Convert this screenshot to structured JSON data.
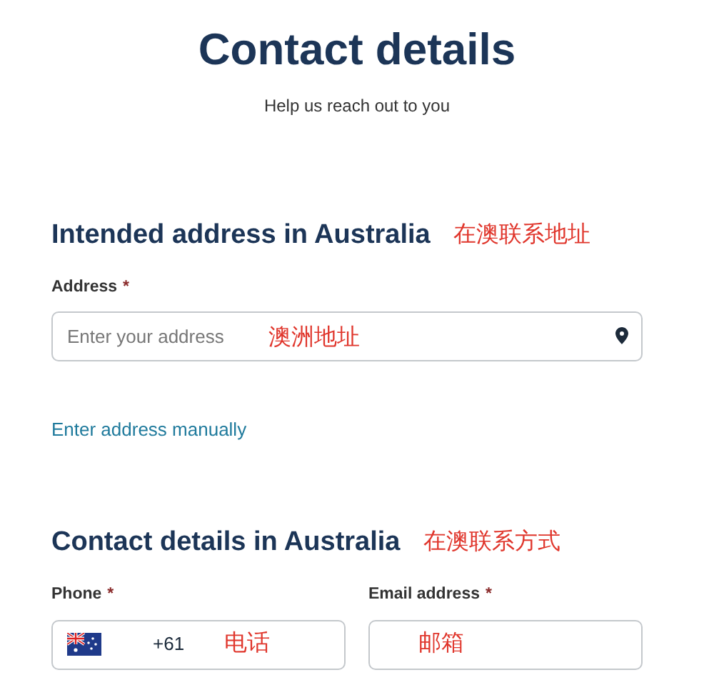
{
  "page": {
    "title": "Contact details",
    "subtitle": "Help us reach out to you"
  },
  "address_section": {
    "heading": "Intended address in Australia",
    "annotation": "在澳联系地址",
    "field": {
      "label": "Address",
      "required_mark": "*",
      "placeholder": "Enter your address",
      "annotation": "澳洲地址"
    },
    "link": "Enter address manually"
  },
  "contact_section": {
    "heading": "Contact details in Australia",
    "annotation": "在澳联系方式",
    "fields": [
      {
        "kind": "phone",
        "label": "Phone",
        "required_mark": "*",
        "prefix": "+61",
        "annotation": "电话"
      },
      {
        "kind": "email",
        "label": "Email address",
        "required_mark": "*",
        "annotation": "邮箱"
      }
    ]
  }
}
